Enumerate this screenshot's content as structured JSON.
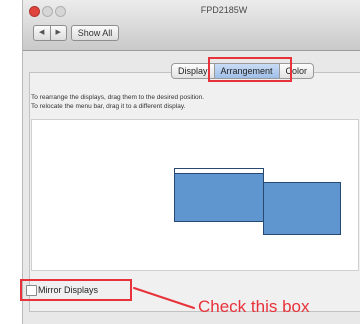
{
  "window": {
    "title": "FPD2185W"
  },
  "toolbar": {
    "back_label": "◀",
    "forward_label": "▶",
    "show_all_label": "Show All"
  },
  "tabs": [
    {
      "label": "Display"
    },
    {
      "label": "Arrangement"
    },
    {
      "label": "Color"
    }
  ],
  "instructions": {
    "line1": "To rearrange the displays, drag them to the desired position.",
    "line2": "To relocate the menu bar, drag it to a different display."
  },
  "mirror": {
    "label": "Mirror Displays",
    "checked": false
  },
  "annotation": {
    "text": "Check this box"
  },
  "colors": {
    "accent_red": "#e8323b",
    "display_blue": "#5f96d0"
  }
}
